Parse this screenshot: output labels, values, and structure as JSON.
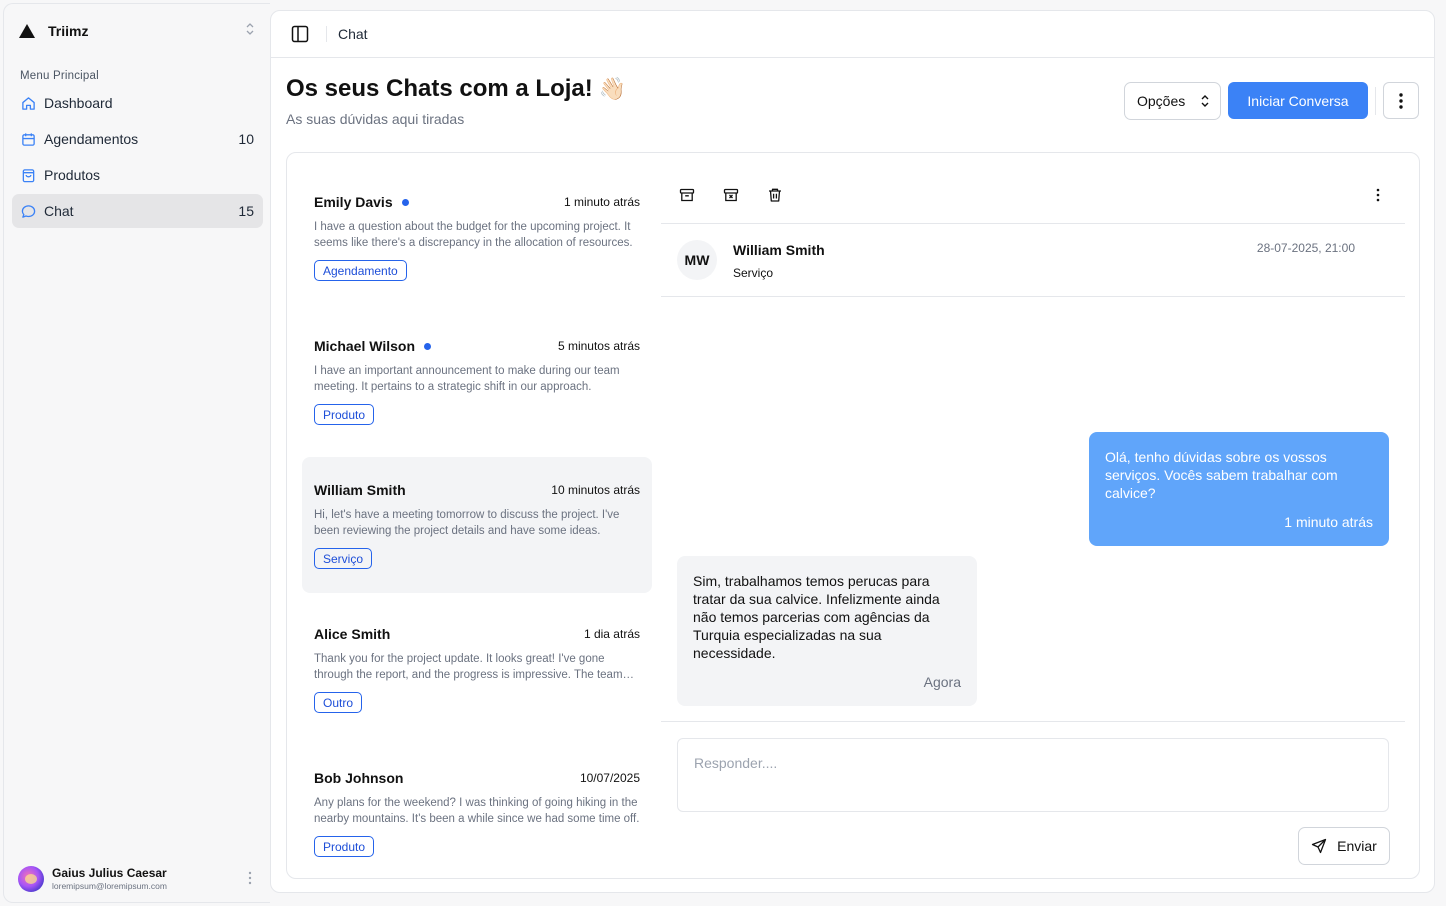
{
  "app": {
    "name": "Triimz"
  },
  "sidebar": {
    "section_label": "Menu Principal",
    "items": [
      {
        "label": "Dashboard",
        "icon": "home-icon",
        "count": ""
      },
      {
        "label": "Agendamentos",
        "icon": "calendar-icon",
        "count": "10"
      },
      {
        "label": "Produtos",
        "icon": "shopping-bag-icon",
        "count": ""
      },
      {
        "label": "Chat",
        "icon": "chat-icon",
        "count": "15",
        "active": true
      }
    ],
    "user": {
      "name": "Gaius Julius Caesar",
      "email": "loremipsum@loremipsum.com"
    }
  },
  "header": {
    "breadcrumb": "Chat"
  },
  "page": {
    "title": "Os seus Chats com a Loja!",
    "emoji": "👋🏻",
    "subtitle": "As suas dúvidas aqui tiradas",
    "options_label": "Opções",
    "start_label": "Iniciar Conversa"
  },
  "conversations": [
    {
      "name": "Emily Davis",
      "unread": true,
      "time": "1 minuto atrás",
      "preview": "I have a question about the budget for the upcoming project. It seems like there's a discrepancy in the allocation of resources.",
      "tag": "Agendamento"
    },
    {
      "name": "Michael Wilson",
      "unread": true,
      "time": "5 minutos atrás",
      "preview": "I have an important announcement to make during our team meeting. It pertains to a strategic shift in our approach.",
      "tag": "Produto"
    },
    {
      "name": "William Smith",
      "unread": false,
      "time": "10 minutos atrás",
      "preview": "Hi, let's have a meeting tomorrow to discuss the project. I've been reviewing the project details and have some ideas.",
      "tag": "Serviço",
      "active": true
    },
    {
      "name": "Alice Smith",
      "unread": false,
      "time": "1 dia atrás",
      "preview": "Thank you for the project update. It looks great! I've gone through the report, and the progress is impressive. The team has done a wonderful job.",
      "tag": "Outro"
    },
    {
      "name": "Bob Johnson",
      "unread": false,
      "time": "10/07/2025",
      "preview": "Any plans for the weekend? I was thinking of going hiking in the nearby mountains. It's been a while since we had some time off.",
      "tag": "Produto"
    }
  ],
  "thread": {
    "initials": "MW",
    "name": "William Smith",
    "type": "Serviço",
    "date": "28-07-2025, 21:00",
    "messages": [
      {
        "direction": "out",
        "text": "Olá, tenho dúvidas sobre os vossos serviços. Vocês sabem trabalhar com calvice?",
        "time": "1 minuto atrás"
      },
      {
        "direction": "in",
        "text": "Sim, trabalhamos temos perucas para tratar da sua calvice. Infelizmente ainda não temos parcerias com agências da Turquia especializadas na sua necessidade.",
        "time": "Agora"
      }
    ],
    "reply_placeholder": "Responder....",
    "send_label": "Enviar"
  },
  "colors": {
    "accent": "#3b82f6",
    "unread_dot": "#2563eb",
    "outgoing_bubble": "#60a5fa",
    "incoming_bubble": "#f3f4f6"
  }
}
